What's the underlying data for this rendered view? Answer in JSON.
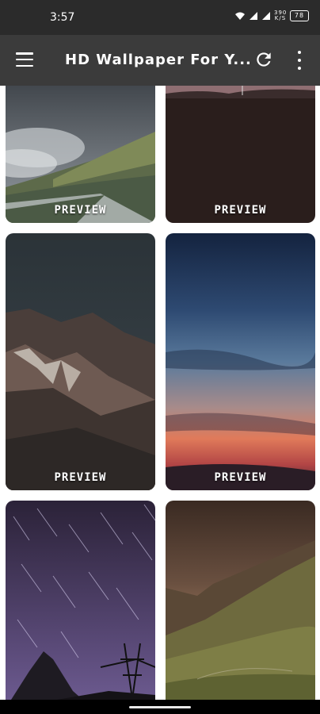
{
  "status_bar": {
    "time": "3:57",
    "icons": [
      "wifi-icon",
      "signal-icon",
      "signal-icon",
      "data-rate",
      "battery-icon"
    ],
    "data_rate": "390 K/S",
    "battery": "78"
  },
  "app_bar": {
    "title": "HD Wallpaper For Y...",
    "menu_icon": "hamburger-menu-icon",
    "refresh_icon": "refresh-icon",
    "more_icon": "more-vert-icon"
  },
  "wallpapers": [
    {
      "preview_label": "PREVIEW"
    },
    {
      "preview_label": "PREVIEW"
    },
    {
      "preview_label": "PREVIEW"
    },
    {
      "preview_label": "PREVIEW"
    },
    {
      "preview_label": "",
      "description": ""
    },
    {
      "preview_label": ""
    }
  ]
}
